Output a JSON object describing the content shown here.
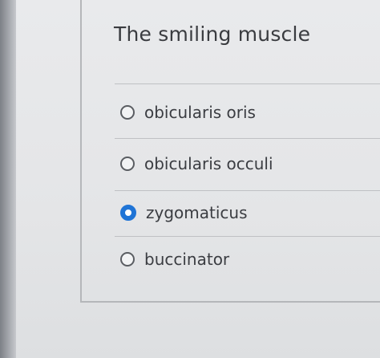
{
  "question": {
    "title": "The smiling muscle",
    "options": [
      {
        "label": "obicularis oris",
        "selected": false
      },
      {
        "label": "obicularis occuli",
        "selected": false
      },
      {
        "label": "zygomaticus",
        "selected": true
      },
      {
        "label": "buccinator",
        "selected": false
      }
    ]
  },
  "colors": {
    "accent": "#1f74d6",
    "text": "#3b3d42",
    "background": "#e4e5e7"
  }
}
